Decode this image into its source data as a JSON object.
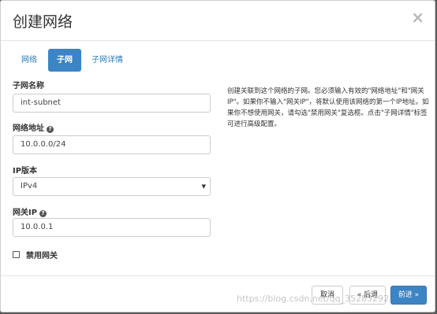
{
  "modal": {
    "title": "创建网络",
    "close_symbol": "×"
  },
  "tabs": [
    {
      "label": "网络",
      "active": false
    },
    {
      "label": "子网",
      "active": true
    },
    {
      "label": "子网详情",
      "active": false
    }
  ],
  "form": {
    "subnet_name": {
      "label": "子网名称",
      "value": "int-subnet"
    },
    "network_address": {
      "label": "网络地址",
      "value": "10.0.0.0/24",
      "help_icon": "question-circle-icon"
    },
    "ip_version": {
      "label": "IP版本",
      "value": "IPv4"
    },
    "gateway_ip": {
      "label": "网关IP",
      "value": "10.0.0.1",
      "help_icon": "question-circle-icon"
    },
    "disable_gateway": {
      "label": "禁用网关",
      "checked": false
    }
  },
  "help_text": "创建关联到这个网络的子网。您必须输入有效的\"网络地址\"和\"网关IP\"。如果你不输入\"网关IP\"，将默认使用该网络的第一个IP地址。如果你不想使用网关，请勾选\"禁用网关\"复选框。点击\"子网详情\"标签可进行高级配置。",
  "footer": {
    "cancel_label": "取消",
    "back_label": "« 后退",
    "next_label": "前进 »"
  },
  "watermark": "https://blog.csdn.net/qq_35283292",
  "colors": {
    "primary": "#3d84c5",
    "link": "#2a7ab8"
  }
}
